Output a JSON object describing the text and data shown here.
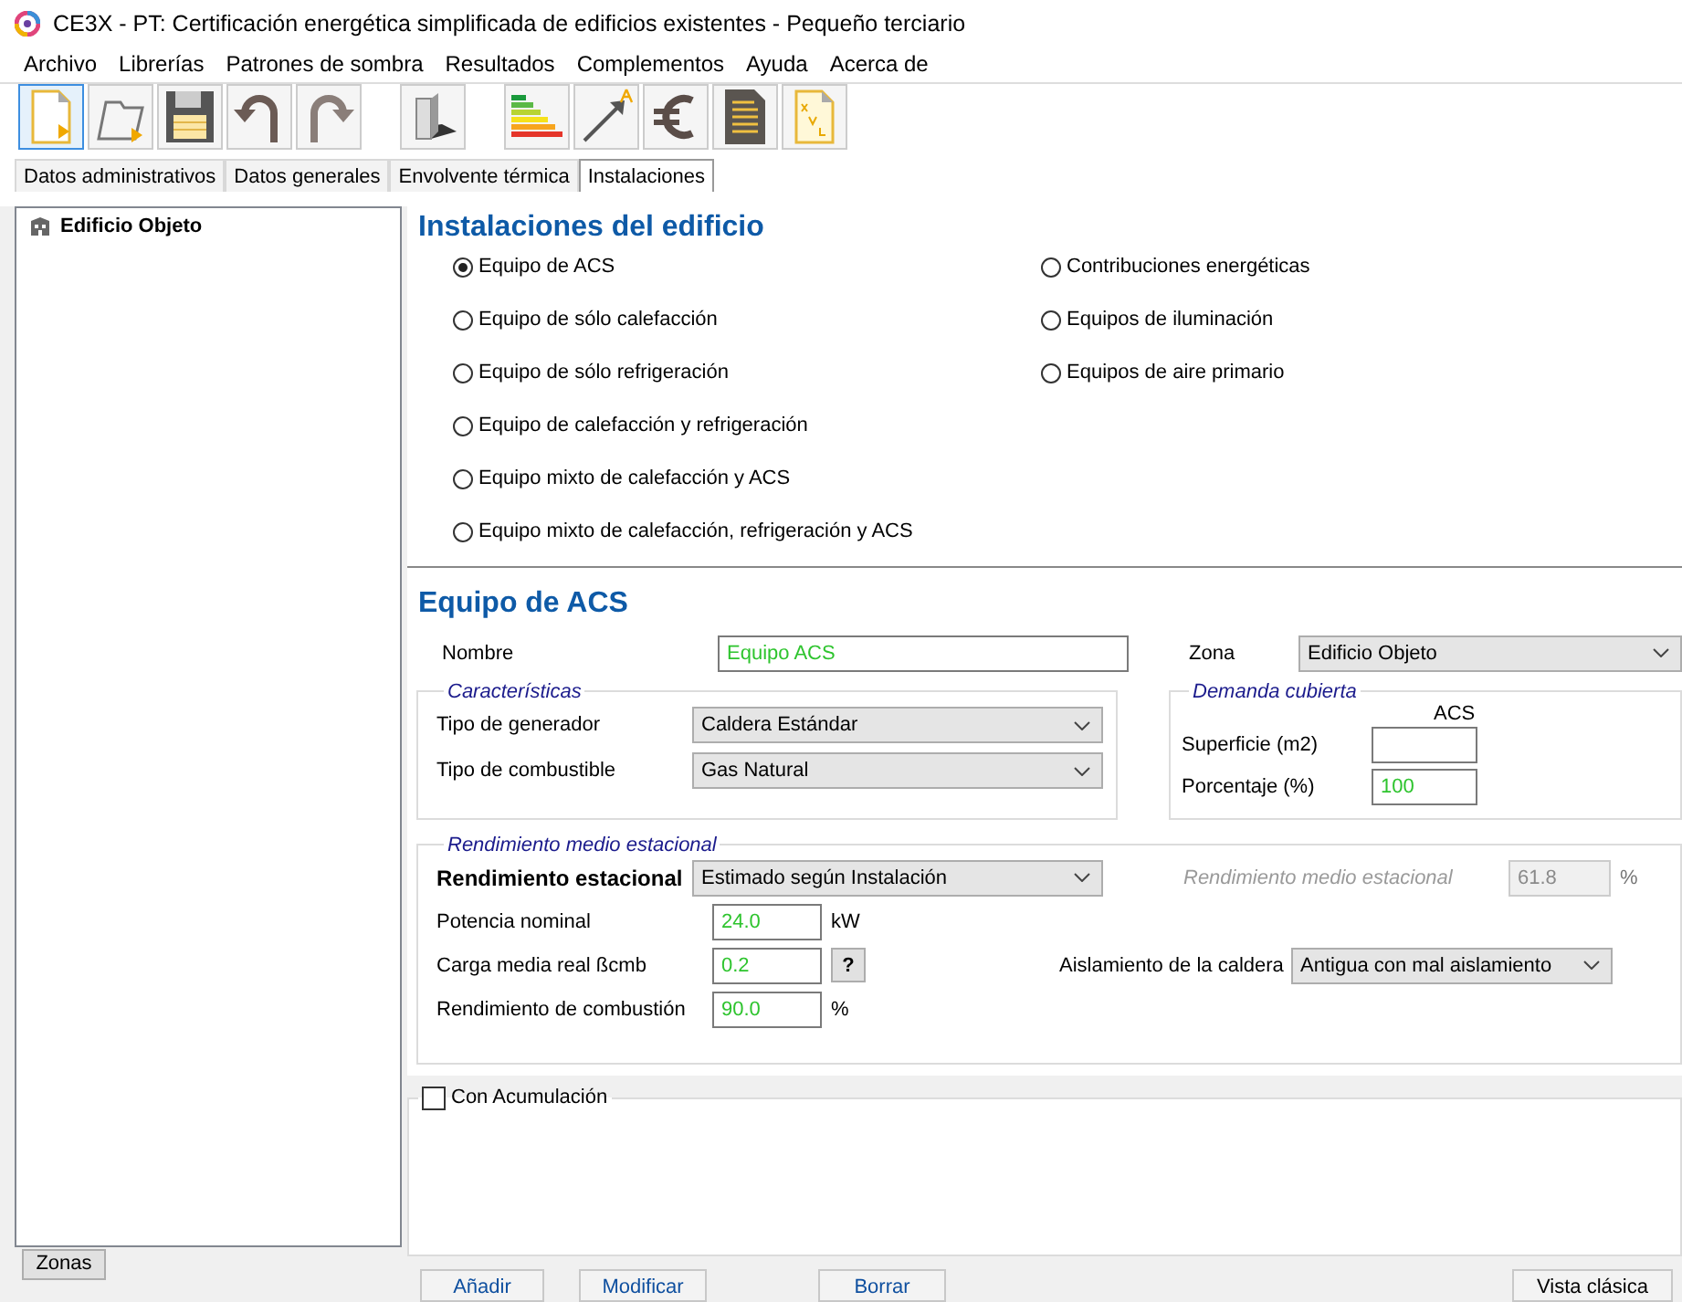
{
  "window": {
    "title": "CE3X - PT: Certificación energética simplificada de edificios existentes - Pequeño terciario"
  },
  "menu": [
    "Archivo",
    "Librerías",
    "Patrones de sombra",
    "Resultados",
    "Complementos",
    "Ayuda",
    "Acerca de"
  ],
  "tabs": [
    {
      "label": "Datos administrativos",
      "selected": false
    },
    {
      "label": "Datos generales",
      "selected": false
    },
    {
      "label": "Envolvente térmica",
      "selected": false
    },
    {
      "label": "Instalaciones",
      "selected": true
    }
  ],
  "tree": {
    "items": [
      {
        "label": "Edificio Objeto"
      }
    ]
  },
  "zones_button": "Zonas",
  "installations": {
    "title": "Instalaciones del edificio",
    "columns": [
      [
        {
          "label": "Equipo de ACS",
          "selected": true
        },
        {
          "label": "Equipo de sólo calefacción",
          "selected": false
        },
        {
          "label": "Equipo de sólo refrigeración",
          "selected": false
        },
        {
          "label": "Equipo de calefacción y refrigeración",
          "selected": false
        },
        {
          "label": "Equipo mixto de calefacción y ACS",
          "selected": false
        },
        {
          "label": "Equipo mixto de calefacción, refrigeración y ACS",
          "selected": false
        }
      ],
      [
        {
          "label": "Contribuciones energéticas",
          "selected": false
        },
        {
          "label": "Equipos de iluminación",
          "selected": false
        },
        {
          "label": "Equipos de aire primario",
          "selected": false
        }
      ]
    ]
  },
  "equipment": {
    "title": "Equipo de ACS",
    "name_label": "Nombre",
    "name_value": "Equipo ACS",
    "zone_label": "Zona",
    "zone_value": "Edificio Objeto",
    "characteristics": {
      "legend": "Características",
      "rows": [
        {
          "label": "Tipo de generador",
          "value": "Caldera Estándar"
        },
        {
          "label": "Tipo de combustible",
          "value": "Gas Natural"
        }
      ]
    },
    "demand": {
      "legend": "Demanda cubierta",
      "column": "ACS",
      "rows": [
        {
          "label": "Superficie (m2)"
        },
        {
          "label": "Porcentaje (%)",
          "value": "100"
        }
      ]
    },
    "performance": {
      "legend": "Rendimiento medio estacional",
      "method_label": "Rendimiento estacional",
      "method_value": "Estimado según Instalación",
      "average_label": "Rendimiento medio estacional",
      "average_value": "61.8",
      "average_unit": "%",
      "rows": [
        {
          "label": "Potencia nominal",
          "value": "24.0",
          "unit": "kW"
        },
        {
          "label": "Carga media real ßcmb",
          "value": "0.2",
          "help": "?"
        },
        {
          "label": "Rendimiento de combustión",
          "value": "90.0",
          "unit": "%"
        }
      ],
      "insulation_label": "Aislamiento de la caldera",
      "insulation_value": "Antigua con mal aislamiento"
    },
    "accumulation": {
      "label": "Con Acumulación",
      "checked": false
    }
  },
  "buttons": [
    "Añadir",
    "Modificar",
    "Borrar"
  ],
  "classic_view_button": "Vista clásica"
}
